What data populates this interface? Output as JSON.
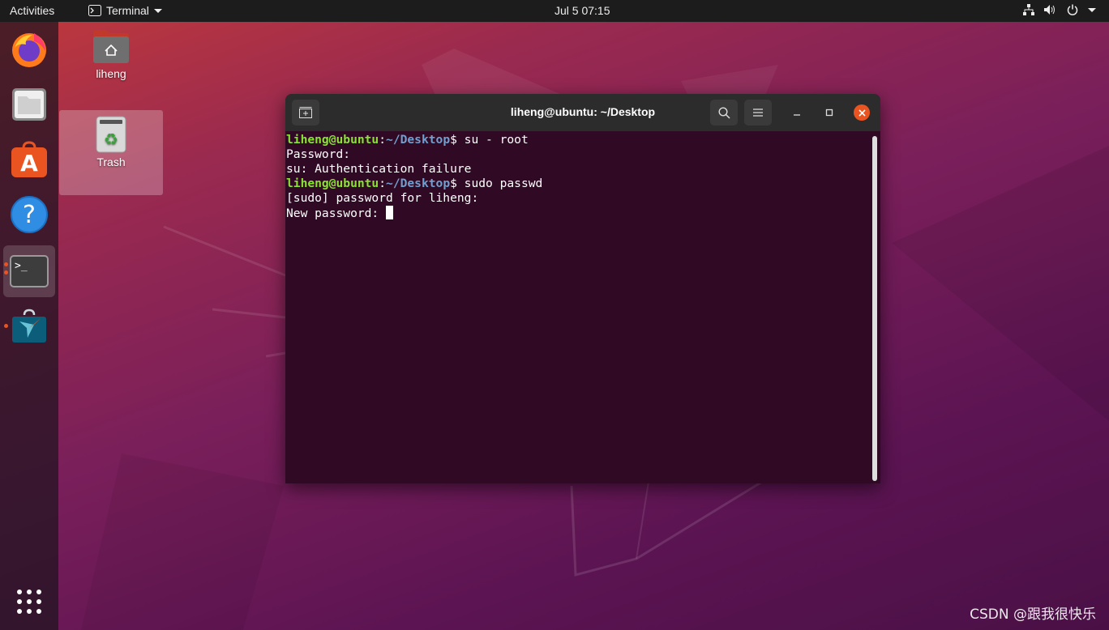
{
  "topbar": {
    "activities": "Activities",
    "app_menu": "Terminal",
    "clock": "Jul 5  07:15"
  },
  "dock": {
    "items": [
      "firefox",
      "files",
      "software",
      "help",
      "terminal",
      "install"
    ]
  },
  "desktop": {
    "icons": [
      {
        "label": "liheng"
      },
      {
        "label": "Trash"
      }
    ]
  },
  "terminal": {
    "title": "liheng@ubuntu: ~/Desktop",
    "lines": [
      {
        "user": "liheng@ubuntu",
        "sep": ":",
        "path": "~/Desktop",
        "rest": "$ su - root"
      },
      {
        "text": "Password:"
      },
      {
        "text": "su: Authentication failure"
      },
      {
        "user": "liheng@ubuntu",
        "sep": ":",
        "path": "~/Desktop",
        "rest": "$ sudo passwd"
      },
      {
        "text": "[sudo] password for liheng:"
      },
      {
        "text": "New password: "
      }
    ]
  },
  "watermark": "CSDN @跟我很快乐",
  "colors": {
    "accent": "#e95420",
    "terminal_bg": "#300a24",
    "prompt_user": "#8ae234",
    "prompt_path": "#729fcf"
  }
}
